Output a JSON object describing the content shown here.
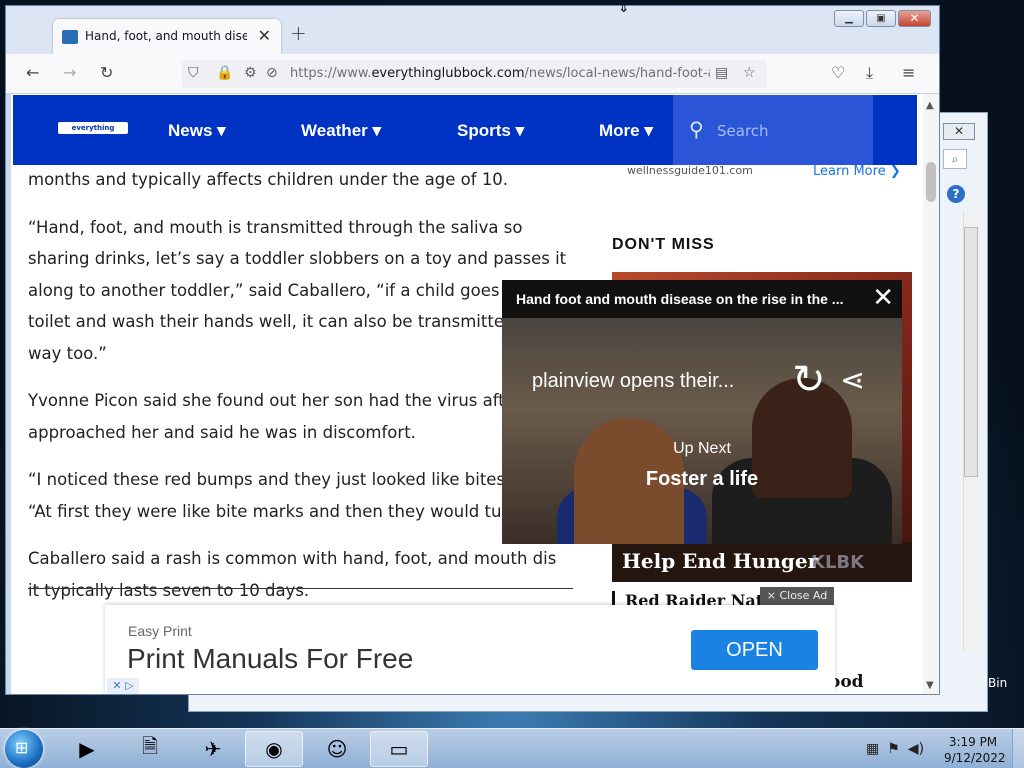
{
  "browser": {
    "tab_title": "Hand, foot, and mouth disease",
    "new_tab": "+",
    "tab_close": "✕",
    "url_prefix": "https://www.",
    "url_host": "everythinglubbock.com",
    "url_path": "/news/local-news/hand-foot-an"
  },
  "site": {
    "logo": "everything lubbock",
    "nav": [
      "News",
      "Weather",
      "Sports",
      "More"
    ],
    "search_placeholder": "Search"
  },
  "article": {
    "paragraphs": [
      "months and typically affects children under the age of 10.",
      "“Hand, foot, and mouth is transmitted through the saliva so sharing drinks, let’s say a toddler slobbers on a toy and passes it along to another toddler,” said Caballero, “if a child goes to the toilet and wash their hands well, it can also be transmitted that way too.”",
      "Yvonne Picon said she found out her son had the virus after he approached her and said he was in discomfort.",
      "“I noticed these red bumps and they just looked like bites,” said “At first they were like bite marks and then they would turn into",
      "Caballero said a rash is common with hand, foot, and mouth dis it typically lasts seven to 10 days."
    ]
  },
  "sidebar": {
    "wellness": "wellnessguide101.com",
    "learn_more": "Learn More ❯",
    "dont_miss": "DON'T MISS",
    "news_caption": "Help End Hunger",
    "news_watermark": "KLBK",
    "headline": "Red Raider Nation",
    "headline2": "ood"
  },
  "video": {
    "title": "Hand foot and mouth disease on the rise in the ...",
    "related": "plainview opens their...",
    "up_next_label": "Up Next",
    "up_next_title": "Foster a life"
  },
  "ad": {
    "close_ad": "× Close Ad",
    "small": "Easy Print",
    "headline": "Print Manuals For Free",
    "button": "OPEN"
  },
  "taskbar": {
    "time": "3:19 PM",
    "date": "9/12/2022",
    "recycle_bin": "Bin"
  }
}
